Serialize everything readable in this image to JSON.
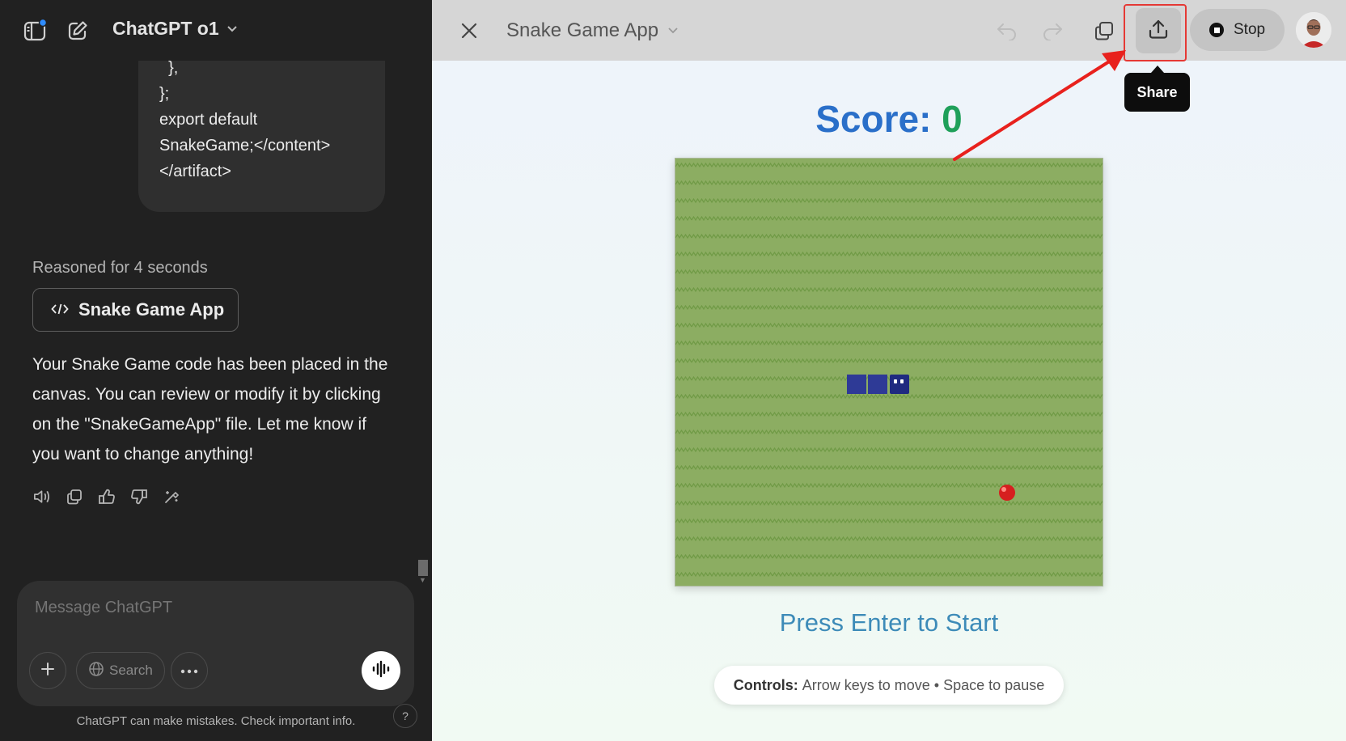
{
  "left": {
    "model_name": "ChatGPT o1",
    "code_lines": [
      "  },",
      "};",
      "",
      "export default",
      "SnakeGame;</content>",
      "</artifact>"
    ],
    "reasoned": "Reasoned for 4 seconds",
    "artifact_label": "Snake Game App",
    "reply": "Your Snake Game code has been placed in the canvas. You can review or modify it by clicking on the \"SnakeGameApp\" file. Let me know if you want to change anything!",
    "composer": {
      "placeholder": "Message ChatGPT",
      "search_label": "Search"
    },
    "disclaimer": "ChatGPT can make mistakes. Check important info.",
    "help_label": "?"
  },
  "canvas": {
    "title": "Snake Game App",
    "stop_label": "Stop",
    "tooltip": "Share",
    "score_label": "Score:",
    "score_value": "0",
    "prompt": "Press Enter to Start",
    "controls_label": "Controls:",
    "controls_text": "Arrow keys to move • Space to pause"
  },
  "colors": {
    "left_bg": "#212121",
    "header_bg": "#d6d6d6",
    "score_label": "#2a6fc9",
    "score_value": "#1fa05a",
    "board_green": "#8cad62",
    "snake": "#2e3a96",
    "snake_head": "#1f2a80",
    "food": "#d61f1f",
    "highlight": "#e53935"
  }
}
